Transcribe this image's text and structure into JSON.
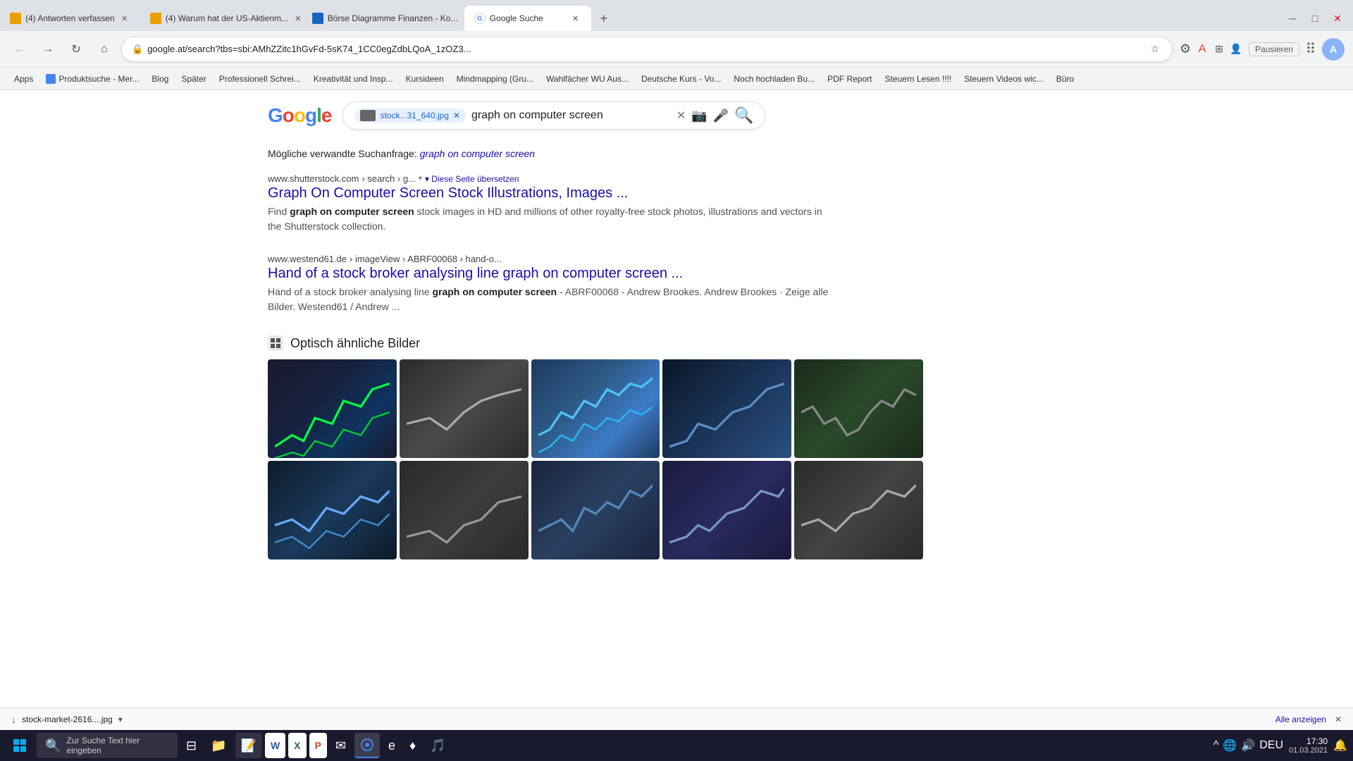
{
  "browser": {
    "tabs": [
      {
        "id": "tab1",
        "favicon_color": "#e8a000",
        "label": "(4) Antworten verfassen",
        "active": false
      },
      {
        "id": "tab2",
        "favicon_color": "#e8a000",
        "label": "(4) Warum hat der US-Aktienm...",
        "active": false
      },
      {
        "id": "tab3",
        "favicon_color": "#1565c0",
        "label": "Börse Diagramme Finanzen - Ko...",
        "active": false
      },
      {
        "id": "tab4",
        "favicon_color": "#4285f4",
        "label": "Google Suche",
        "active": true
      }
    ],
    "url": "google.at/search?tbs=sbi:AMhZZitc1hGvFd-5sK74_1CC0egZdbLQoA_1zOZ3-hvFm-NaKtCQd04gkJ2X_1ISiHq0QIbGA6cLXn5NyA8PtY0btoiMoi-a4pHH3hjz0gCBe98MbIjSB1I1q_1b_1iev1b1a_1eSCE3cJq8xzHirJPcc0p6EHlDrzbqFjzA...",
    "url_display": "google.at/search?tbs=sbi:AMhZZitc1hGvFd-5sK74_1CC0egZdbLQoA_1zOZ3...",
    "bookmarks": [
      "Apps",
      "Produktsuche - Mer...",
      "Blog",
      "Später",
      "Professionell Schrei...",
      "Kreativität und Insp...",
      "Kursideen",
      "Mindmapping (Gru...",
      "Wahlfächer WU Aus...",
      "Deutsche Kurs - Vo...",
      "Noch hochladen Bu...",
      "PDF Report",
      "Steuern Lesen !!!!",
      "Steuern Videos wic...",
      "Büro"
    ]
  },
  "search": {
    "image_tag": "stock...31_640.jpg",
    "query": "graph on computer screen",
    "placeholder": "graph on computer screen"
  },
  "results": {
    "related_query_prefix": "Mögliche verwandte Suchanfrage:",
    "related_query_link": "graph on computer screen",
    "items": [
      {
        "url_domain": "www.shutterstock.com",
        "url_path": "› search › g...",
        "translate_label": "▾ Diese Seite übersetzen",
        "title": "Graph On Computer Screen Stock Illustrations, Images ...",
        "desc_parts": [
          {
            "text": "Find ",
            "bold": false
          },
          {
            "text": "graph on computer screen",
            "bold": true
          },
          {
            "text": " stock images in HD and millions of other royalty-free stock photos, illustrations and vectors in the Shutterstock collection.",
            "bold": false
          }
        ]
      },
      {
        "url_domain": "www.westend61.de",
        "url_path": "› imageView › ABRF00068 › hand-o...",
        "title": "Hand of a stock broker analysing line graph on computer screen ...",
        "desc_parts": [
          {
            "text": "Hand of a stock broker analysing line ",
            "bold": false
          },
          {
            "text": "graph on computer screen",
            "bold": true
          },
          {
            "text": " - ABRF00068 - Andrew Brookes. Andrew Brookes · Zeige alle Bilder. Westend61 / Andrew ...",
            "bold": false
          }
        ]
      }
    ],
    "similar_images_header": "Optisch ähnliche Bilder",
    "similar_images": [
      {
        "id": 1,
        "bg_class": "img-t1"
      },
      {
        "id": 2,
        "bg_class": "img-t2"
      },
      {
        "id": 3,
        "bg_class": "img-t3"
      },
      {
        "id": 4,
        "bg_class": "img-t4"
      },
      {
        "id": 5,
        "bg_class": "img-t5"
      },
      {
        "id": 6,
        "bg_class": "img-t6"
      },
      {
        "id": 7,
        "bg_class": "img-t7"
      },
      {
        "id": 8,
        "bg_class": "img-t8"
      },
      {
        "id": 9,
        "bg_class": "img-t9"
      },
      {
        "id": 10,
        "bg_class": "img-t10"
      }
    ]
  },
  "status_bar": {
    "download_filename": "stock-market-2616....jpg",
    "download_icon": "↓",
    "show_all_label": "Alle anzeigen",
    "close_label": "✕"
  },
  "taskbar": {
    "start_icon": "⊞",
    "items": [
      "⊟",
      "📁",
      "📝",
      "W",
      "X",
      "P",
      "✉",
      "🌐",
      "e",
      "♦",
      "🎵"
    ],
    "search_placeholder": "Zur Suche Text hier eingeben",
    "time": "17:30",
    "date": "01.03.2021",
    "layout_icon": "DEU"
  },
  "header": {
    "logo_letters": [
      "G",
      "o",
      "o",
      "g",
      "l",
      "e"
    ],
    "pause_label": "Pausieren",
    "apps_icon": "⠿",
    "profile_initial": "A"
  }
}
